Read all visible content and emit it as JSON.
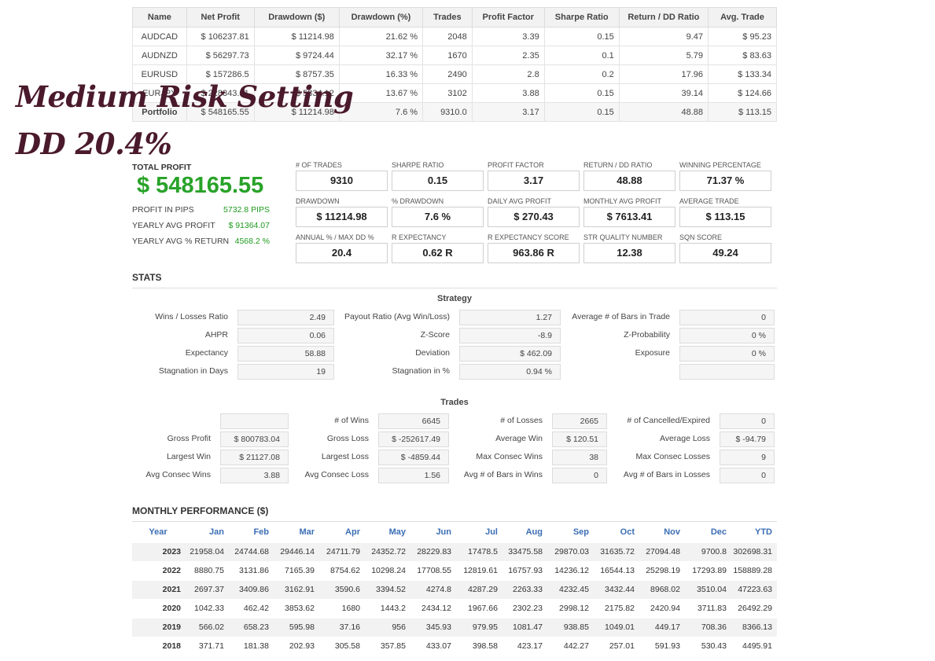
{
  "symbols_table": {
    "headers": [
      "Name",
      "Net Profit",
      "Drawdown ($)",
      "Drawdown (%)",
      "Trades",
      "Profit Factor",
      "Sharpe Ratio",
      "Return / DD Ratio",
      "Avg. Trade"
    ],
    "rows": [
      [
        "AUDCAD",
        "$ 106237.81",
        "$ 11214.98",
        "21.62 %",
        "2048",
        "3.39",
        "0.15",
        "9.47",
        "$ 95.23"
      ],
      [
        "AUDNZD",
        "$ 56297.73",
        "$ 9724.44",
        "32.17 %",
        "1670",
        "2.35",
        "0.1",
        "5.79",
        "$ 83.63"
      ],
      [
        "EURUSD",
        "$ 157286.5",
        "$ 8757.35",
        "16.33 %",
        "2490",
        "2.8",
        "0.2",
        "17.96",
        "$ 133.34"
      ],
      [
        "EURJPY",
        "$ 228343.61",
        "$ 5834.12",
        "13.67 %",
        "3102",
        "3.88",
        "0.15",
        "39.14",
        "$ 124.66"
      ],
      [
        "Portfolio",
        "$ 548165.55",
        "$ 11214.98",
        "7.6 %",
        "9310.0",
        "3.17",
        "0.15",
        "48.88",
        "$ 113.15"
      ]
    ]
  },
  "overlay": {
    "line1": "Medium Risk Setting",
    "line2": "DD 20.4%"
  },
  "summary": {
    "total_profit_label": "TOTAL PROFIT",
    "total_profit_value": "$ 548165.55",
    "rows": [
      {
        "label": "PROFIT IN PIPS",
        "value": "5732.8 PIPS"
      },
      {
        "label": "YEARLY AVG PROFIT",
        "value": "$ 91364.07"
      },
      {
        "label": "YEARLY AVG % RETURN",
        "value": "4568.2 %"
      }
    ]
  },
  "kpis": [
    {
      "label": "# OF TRADES",
      "value": "9310"
    },
    {
      "label": "SHARPE RATIO",
      "value": "0.15"
    },
    {
      "label": "PROFIT FACTOR",
      "value": "3.17"
    },
    {
      "label": "RETURN / DD RATIO",
      "value": "48.88"
    },
    {
      "label": "WINNING PERCENTAGE",
      "value": "71.37 %"
    },
    {
      "label": "DRAWDOWN",
      "value": "$ 11214.98"
    },
    {
      "label": "% DRAWDOWN",
      "value": "7.6 %"
    },
    {
      "label": "DAILY AVG PROFIT",
      "value": "$ 270.43"
    },
    {
      "label": "MONTHLY AVG PROFIT",
      "value": "$ 7613.41"
    },
    {
      "label": "AVERAGE TRADE",
      "value": "$ 113.15"
    },
    {
      "label": "ANNUAL % / MAX DD %",
      "value": "20.4"
    },
    {
      "label": "R EXPECTANCY",
      "value": "0.62 R"
    },
    {
      "label": "R EXPECTANCY SCORE",
      "value": "963.86 R"
    },
    {
      "label": "STR QUALITY NUMBER",
      "value": "12.38"
    },
    {
      "label": "SQN SCORE",
      "value": "49.24"
    }
  ],
  "stats": {
    "title": "STATS",
    "strategy": {
      "title": "Strategy",
      "col1": [
        {
          "label": "Wins / Losses Ratio",
          "value": "2.49"
        },
        {
          "label": "AHPR",
          "value": "0.06"
        },
        {
          "label": "Expectancy",
          "value": "58.88"
        },
        {
          "label": "Stagnation in Days",
          "value": "19"
        }
      ],
      "col2": [
        {
          "label": "Payout Ratio (Avg Win/Loss)",
          "value": "1.27"
        },
        {
          "label": "Z-Score",
          "value": "-8.9"
        },
        {
          "label": "Deviation",
          "value": "$ 462.09"
        },
        {
          "label": "Stagnation in %",
          "value": "0.94 %"
        }
      ],
      "col3": [
        {
          "label": "Average # of Bars in Trade",
          "value": "0"
        },
        {
          "label": "Z-Probability",
          "value": "0 %"
        },
        {
          "label": "Exposure",
          "value": "0 %"
        },
        {
          "label": "",
          "value": ""
        }
      ]
    },
    "trades": {
      "title": "Trades",
      "col1": [
        {
          "label": "",
          "value": ""
        },
        {
          "label": "Gross Profit",
          "value": "$ 800783.04"
        },
        {
          "label": "Largest Win",
          "value": "$ 21127.08"
        },
        {
          "label": "Avg Consec Wins",
          "value": "3.88"
        }
      ],
      "col2": [
        {
          "label": "# of Wins",
          "value": "6645"
        },
        {
          "label": "Gross Loss",
          "value": "$ -252617.49"
        },
        {
          "label": "Largest Loss",
          "value": "$ -4859.44"
        },
        {
          "label": "Avg Consec Loss",
          "value": "1.56"
        }
      ],
      "col3": [
        {
          "label": "# of Losses",
          "value": "2665"
        },
        {
          "label": "Average Win",
          "value": "$ 120.51"
        },
        {
          "label": "Max Consec Wins",
          "value": "38"
        },
        {
          "label": "Avg # of Bars in Wins",
          "value": "0"
        }
      ],
      "col4": [
        {
          "label": "# of Cancelled/Expired",
          "value": "0"
        },
        {
          "label": "Average Loss",
          "value": "$ -94.79"
        },
        {
          "label": "Max Consec Losses",
          "value": "9"
        },
        {
          "label": "Avg # of Bars in Losses",
          "value": "0"
        }
      ]
    }
  },
  "monthly": {
    "title": "MONTHLY PERFORMANCE ($)",
    "headers": [
      "Year",
      "Jan",
      "Feb",
      "Mar",
      "Apr",
      "May",
      "Jun",
      "Jul",
      "Aug",
      "Sep",
      "Oct",
      "Nov",
      "Dec",
      "YTD"
    ],
    "rows": [
      [
        "2023",
        "21958.04",
        "24744.68",
        "29446.14",
        "24711.79",
        "24352.72",
        "28229.83",
        "17478.5",
        "33475.58",
        "29870.03",
        "31635.72",
        "27094.48",
        "9700.8",
        "302698.31"
      ],
      [
        "2022",
        "8880.75",
        "3131.86",
        "7165.39",
        "8754.62",
        "10298.24",
        "17708.55",
        "12819.61",
        "16757.93",
        "14236.12",
        "16544.13",
        "25298.19",
        "17293.89",
        "158889.28"
      ],
      [
        "2021",
        "2697.37",
        "3409.86",
        "3162.91",
        "3590.6",
        "3394.52",
        "4274.8",
        "4287.29",
        "2263.33",
        "4232.45",
        "3432.44",
        "8968.02",
        "3510.04",
        "47223.63"
      ],
      [
        "2020",
        "1042.33",
        "462.42",
        "3853.62",
        "1680",
        "1443.2",
        "2434.12",
        "1967.66",
        "2302.23",
        "2998.12",
        "2175.82",
        "2420.94",
        "3711.83",
        "26492.29"
      ],
      [
        "2019",
        "566.02",
        "658.23",
        "595.98",
        "37.16",
        "956",
        "345.93",
        "979.95",
        "1081.47",
        "938.85",
        "1049.01",
        "449.17",
        "708.36",
        "8366.13"
      ],
      [
        "2018",
        "371.71",
        "181.38",
        "202.93",
        "305.58",
        "357.85",
        "433.07",
        "398.58",
        "423.17",
        "442.27",
        "257.01",
        "591.93",
        "530.43",
        "4495.91"
      ]
    ]
  }
}
